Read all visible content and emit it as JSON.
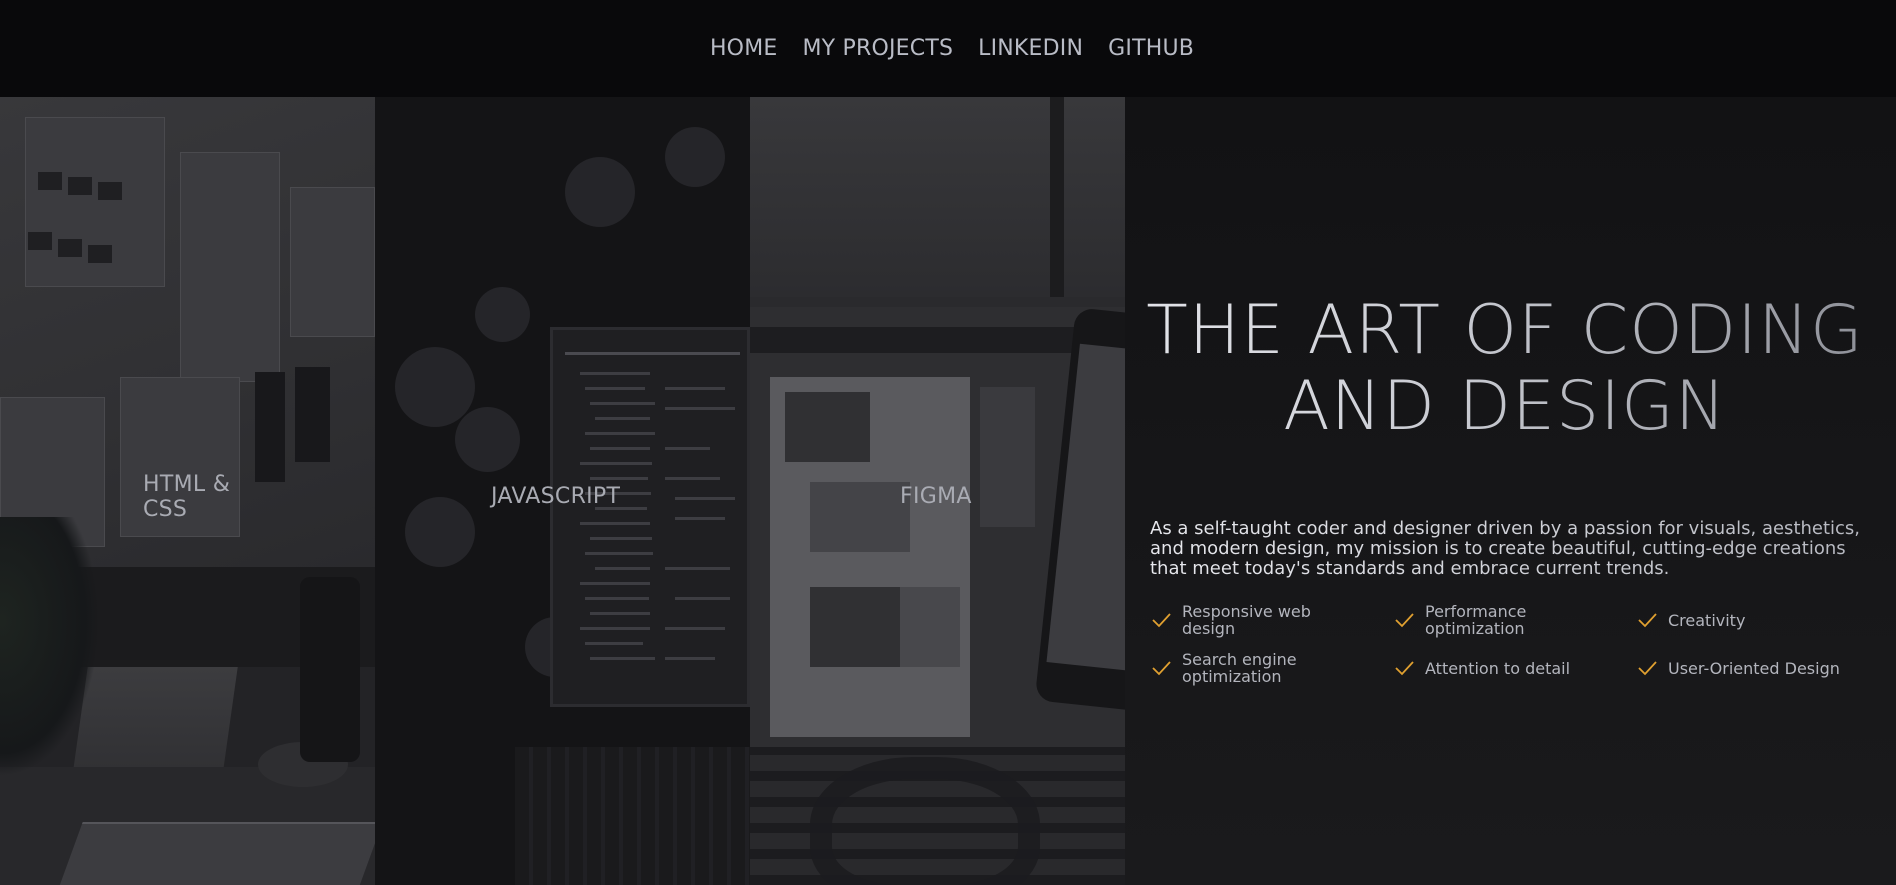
{
  "nav": {
    "items": [
      {
        "label": "HOME"
      },
      {
        "label": "MY PROJECTS"
      },
      {
        "label": "LINKEDIN"
      },
      {
        "label": "GITHUB"
      }
    ]
  },
  "panels": [
    {
      "label": "HTML &\nCSS"
    },
    {
      "label": "JAVASCRIPT"
    },
    {
      "label": "FIGMA"
    }
  ],
  "hero": {
    "title": "THE ART OF CODING AND DESIGN",
    "description": "As a self-taught coder and designer driven by a passion for visuals, aesthetics, and modern design, my mission is to create beautiful, cutting-edge creations that meet today's standards and embrace current trends.",
    "features": [
      {
        "label": "Responsive web design",
        "icon": "check-icon"
      },
      {
        "label": "Performance optimization",
        "icon": "check-icon"
      },
      {
        "label": "Creativity",
        "icon": "check-icon"
      },
      {
        "label": "Search engine optimization",
        "icon": "check-icon"
      },
      {
        "label": "Attention to detail",
        "icon": "check-icon"
      },
      {
        "label": "User-Oriented Design",
        "icon": "check-icon"
      }
    ]
  },
  "colors": {
    "accent": "#e0a030",
    "background": "#141416",
    "nav_background": "#09090b",
    "nav_text": "#b9bcc6"
  }
}
